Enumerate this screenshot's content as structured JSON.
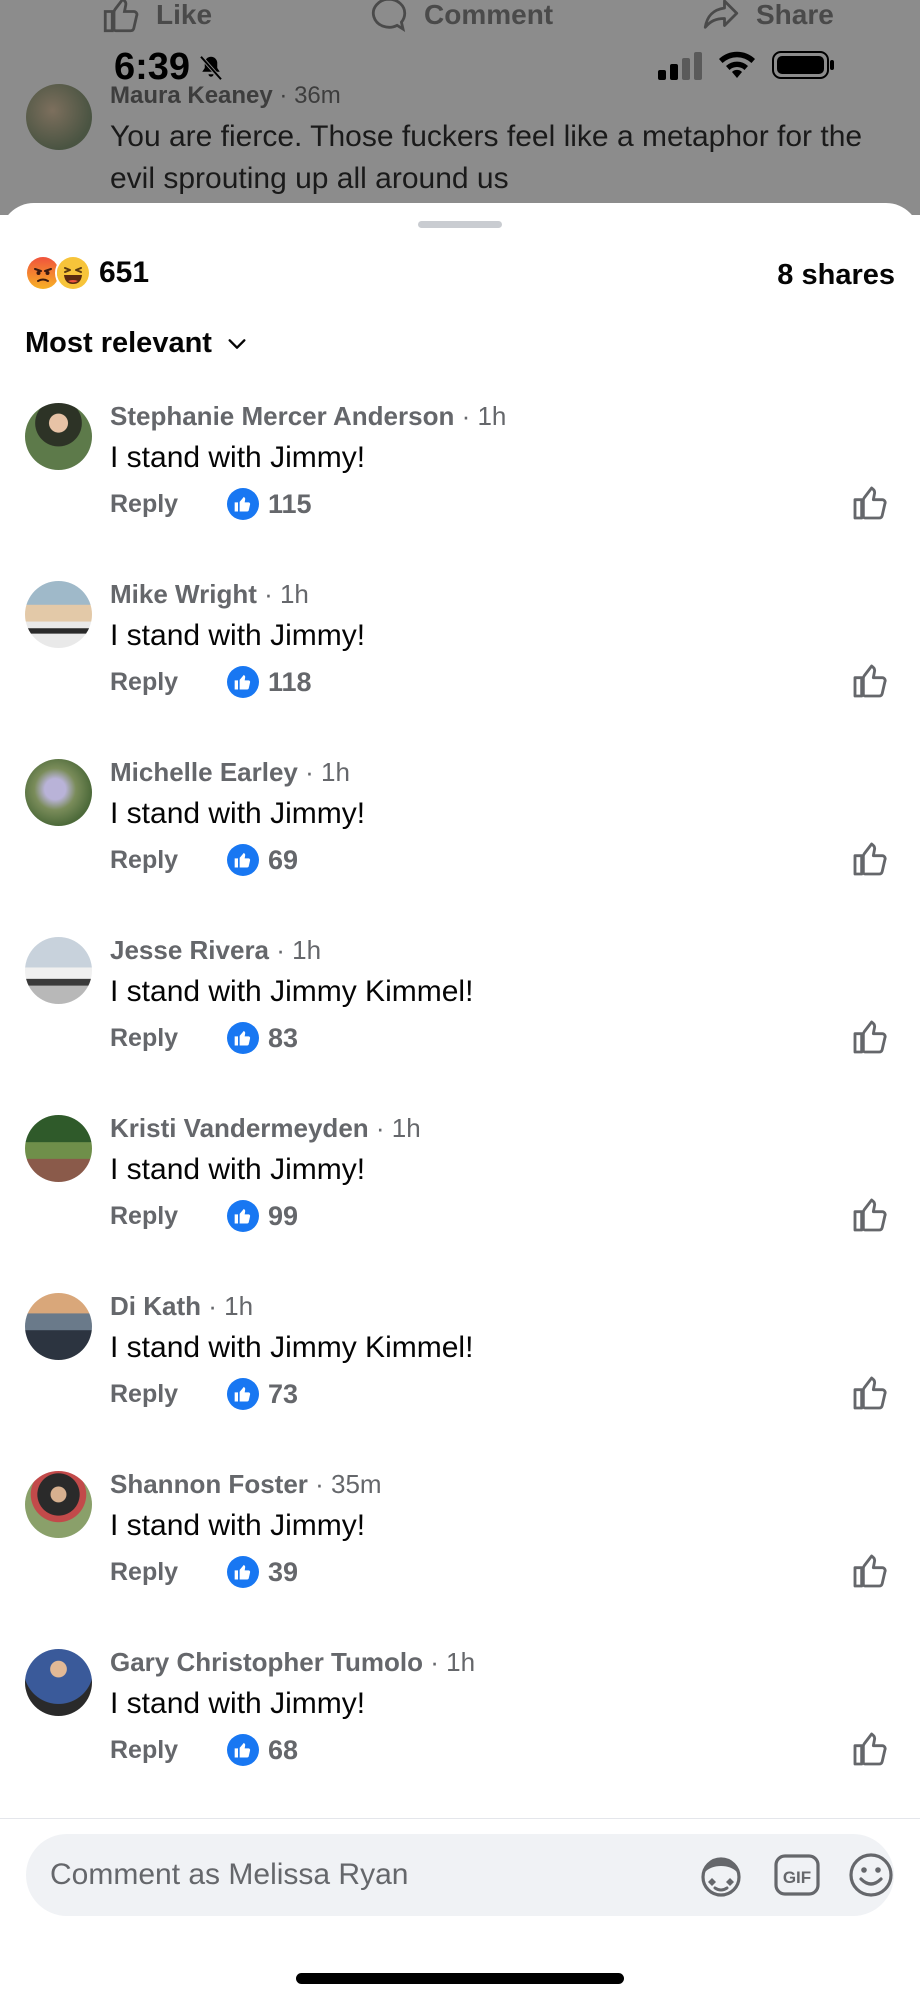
{
  "background": {
    "actions": [
      {
        "label": "Like"
      },
      {
        "label": "Comment"
      },
      {
        "label": "Share"
      }
    ],
    "status_bar": {
      "time": "6:39"
    },
    "comment": {
      "author": "Maura Keaney",
      "time": "36m",
      "text": "You are fierce.  Those fuckers feel like a metaphor for the evil sprouting up all around us"
    }
  },
  "summary": {
    "reaction_count": "651",
    "reaction_icons": [
      "angry-emoji-icon",
      "haha-emoji-icon"
    ],
    "shares": "8 shares"
  },
  "sort": {
    "label": "Most relevant"
  },
  "comments": [
    {
      "author": "Stephanie Mercer Anderson",
      "time": "1h",
      "text": "I stand with Jimmy!",
      "reply": "Reply",
      "likes": "115"
    },
    {
      "author": "Mike Wright",
      "time": "1h",
      "text": "I stand with Jimmy!",
      "reply": "Reply",
      "likes": "118"
    },
    {
      "author": "Michelle Earley",
      "time": "1h",
      "text": "I stand with Jimmy!",
      "reply": "Reply",
      "likes": "69"
    },
    {
      "author": "Jesse Rivera",
      "time": "1h",
      "text": "I stand with Jimmy Kimmel!",
      "reply": "Reply",
      "likes": "83"
    },
    {
      "author": "Kristi Vandermeyden",
      "time": "1h",
      "text": "I stand with Jimmy!",
      "reply": "Reply",
      "likes": "99"
    },
    {
      "author": "Di Kath",
      "time": "1h",
      "text": "I stand with Jimmy Kimmel!",
      "reply": "Reply",
      "likes": "73"
    },
    {
      "author": "Shannon Foster",
      "time": "35m",
      "text": "I stand with Jimmy!",
      "reply": "Reply",
      "likes": "39"
    },
    {
      "author": "Gary Christopher Tumolo",
      "time": "1h",
      "text": "I stand with Jimmy!",
      "reply": "Reply",
      "likes": "68"
    }
  ],
  "composer": {
    "placeholder": "Comment as Melissa Ryan",
    "icons": [
      "avatar-sticker-icon",
      "gif-icon",
      "emoji-icon"
    ]
  },
  "colors": {
    "accent": "#1877f2",
    "secondary_text": "#65676b",
    "primary_text": "#050505",
    "dim_overlay": "#8c8c8c"
  }
}
